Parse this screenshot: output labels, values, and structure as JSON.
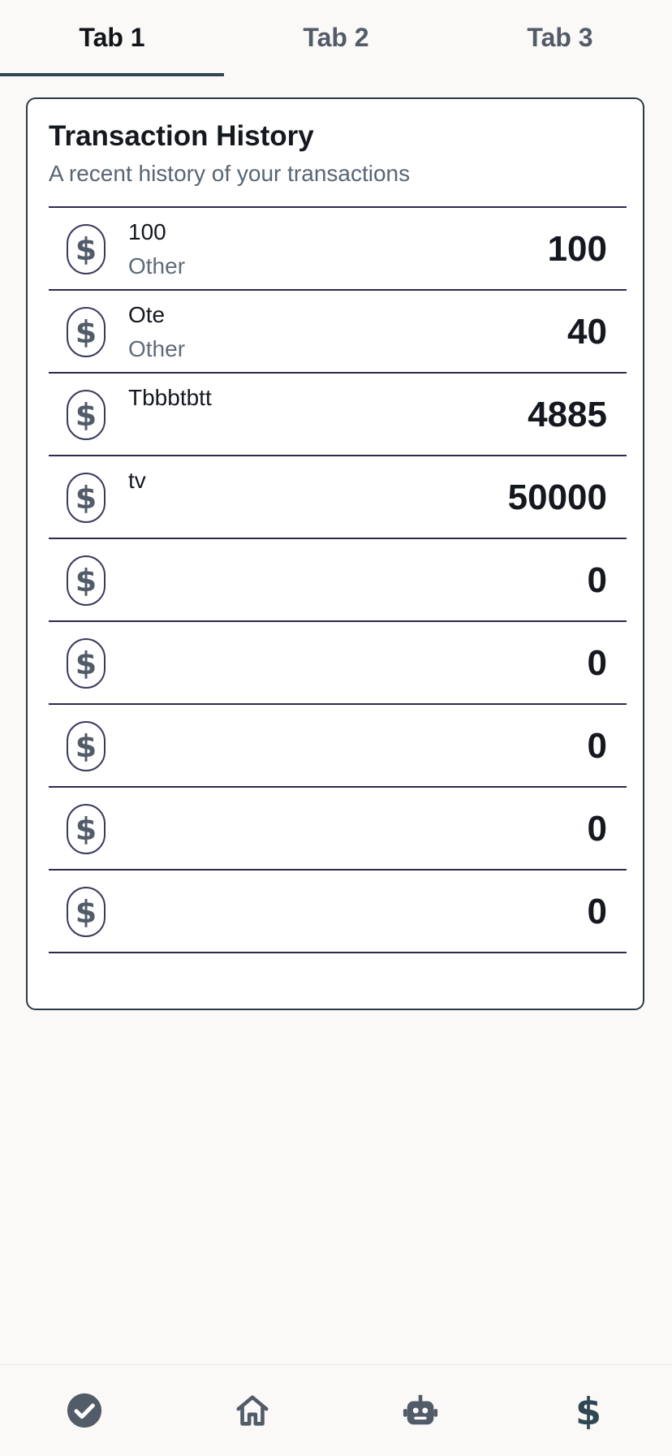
{
  "tabs": [
    {
      "label": "Tab 1",
      "active": true
    },
    {
      "label": "Tab 2",
      "active": false
    },
    {
      "label": "Tab 3",
      "active": false
    }
  ],
  "card": {
    "title": "Transaction History",
    "subtitle": "A recent history of your transactions"
  },
  "transactions": [
    {
      "name": "100",
      "category": "Other",
      "amount": "100"
    },
    {
      "name": "Ote",
      "category": "Other",
      "amount": "40"
    },
    {
      "name": "Tbbbtbtt",
      "category": "",
      "amount": "4885"
    },
    {
      "name": "tv",
      "category": "",
      "amount": "50000"
    },
    {
      "name": "",
      "category": "",
      "amount": "0"
    },
    {
      "name": "",
      "category": "",
      "amount": "0"
    },
    {
      "name": "",
      "category": "",
      "amount": "0"
    },
    {
      "name": "",
      "category": "",
      "amount": "0"
    },
    {
      "name": "",
      "category": "",
      "amount": "0"
    }
  ],
  "bottom_nav": [
    {
      "icon": "check-circle-icon"
    },
    {
      "icon": "home-icon"
    },
    {
      "icon": "robot-icon"
    },
    {
      "icon": "dollar-icon"
    }
  ],
  "colors": {
    "background": "#faf9f7",
    "accent": "#304652",
    "icon": "#525b68"
  }
}
